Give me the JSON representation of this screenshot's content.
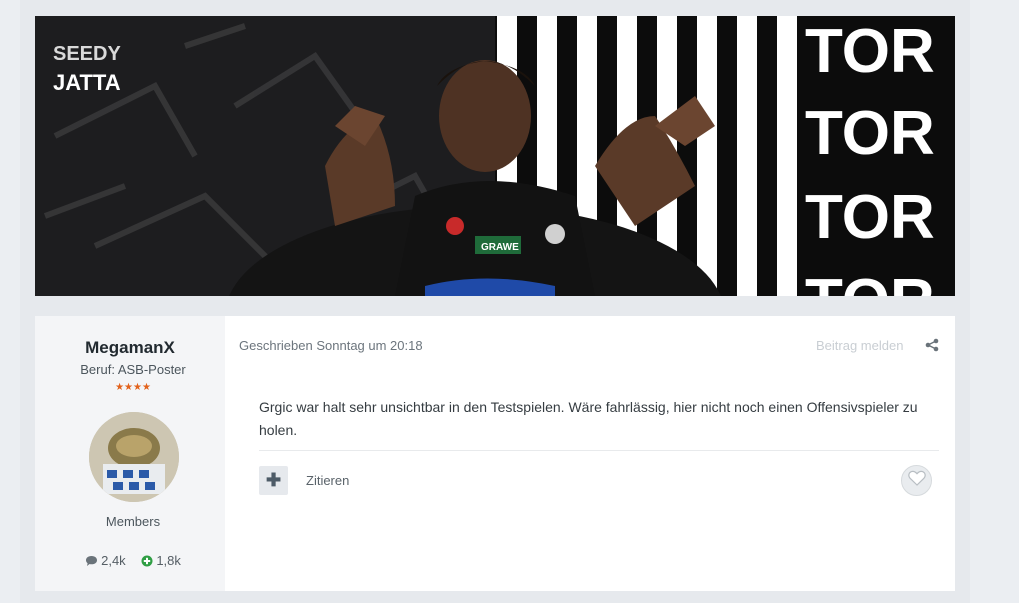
{
  "banner": {
    "name_line1": "SEEDY",
    "name_line2": "JATTA",
    "stripe_word": "TOR",
    "shirt_sponsor": "GRAWE"
  },
  "post": {
    "author": {
      "name": "MegamanX",
      "title": "Beruf: ASB-Poster",
      "stars": "★★★★",
      "group": "Members",
      "posts_count": "2,4k",
      "reputation": "1,8k"
    },
    "meta": {
      "prefix": "Geschrieben",
      "time": "Sonntag um 20:18"
    },
    "report_label": "Beitrag melden",
    "content": "Grgic war halt sehr unsichtbar in den Testspielen. Wäre fahrlässig, hier nicht noch einen Offensivspieler zu holen.",
    "multiquote_symbol": "✚",
    "quote_label": "Zitieren"
  },
  "colors": {
    "accent": "#e2621c",
    "background": "#ebeef2",
    "panel": "#ffffff"
  },
  "icons": [
    "comment-icon",
    "plus-circle-icon",
    "share-icon",
    "heart-icon"
  ]
}
